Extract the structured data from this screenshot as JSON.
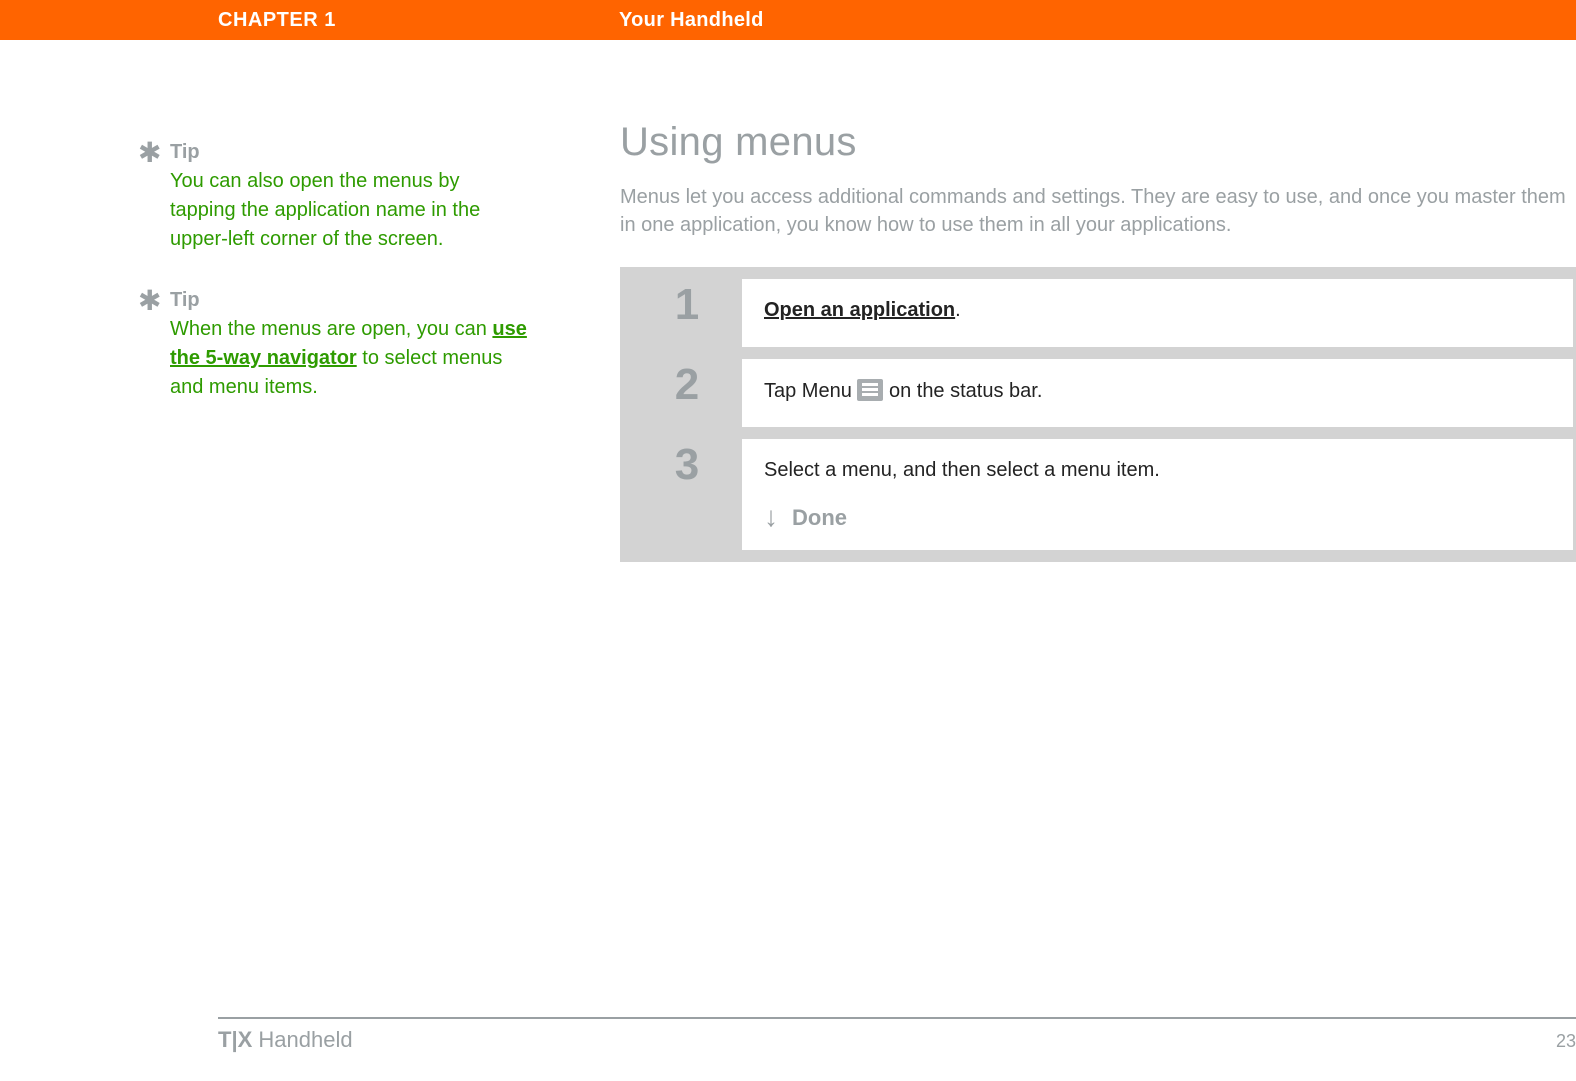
{
  "header": {
    "chapter": "CHAPTER 1",
    "topic": "Your Handheld"
  },
  "sidebar": {
    "tips": [
      {
        "label": "Tip",
        "body": {
          "prefix": "You can also open the menus by tapping the application name in the upper-left corner of the screen.",
          "link": "",
          "suffix": ""
        }
      },
      {
        "label": "Tip",
        "body": {
          "prefix": "When the menus are open, you can ",
          "link": "use the 5-way navigator",
          "suffix": " to select menus and menu items."
        }
      }
    ]
  },
  "main": {
    "title": "Using menus",
    "intro": "Menus let you access additional commands and settings. They are easy to use, and once you master them in one application, you know how to use them in all your applications.",
    "steps": [
      {
        "num": "1",
        "link_text": "Open an application",
        "after_link": "."
      },
      {
        "num": "2",
        "prefix": "Tap Menu ",
        "suffix": " on the status bar."
      },
      {
        "num": "3",
        "text": "Select a menu, and then select a menu item.",
        "done": "Done"
      }
    ]
  },
  "footer": {
    "product_bold": "T|X",
    "product_rest": " Handheld",
    "page": "23"
  }
}
